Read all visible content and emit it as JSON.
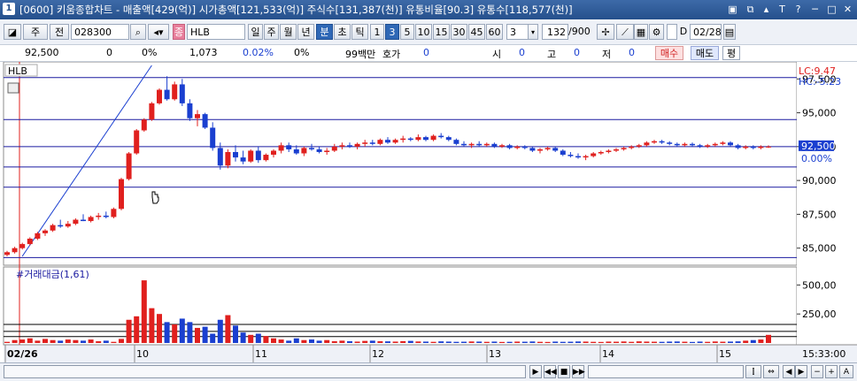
{
  "title": {
    "window_no": "1",
    "text": "[0600] 키움종합차트 - 매출액[429(억)] 시가총액[121,533(억)] 주식수[131,387(천)] 유통비율[90.3] 유통수[118,577(천)]"
  },
  "toolbar": {
    "market": "주",
    "prev": "전",
    "code": "028300",
    "badge": "종",
    "name": "HLB",
    "periods": [
      "일",
      "주",
      "월",
      "년",
      "분",
      "초",
      "틱"
    ],
    "selected_period": "분",
    "intervals": [
      "1",
      "3",
      "5",
      "10",
      "15",
      "30",
      "45",
      "60"
    ],
    "selected_interval": "3",
    "interval_value": "3",
    "count": "132",
    "count_total": "/900",
    "date_label": "D",
    "date": "02/28"
  },
  "quote": {
    "price": "92,500",
    "change": "0",
    "change_pct": "0%",
    "volume": "1,073",
    "volume_pct": "0.02%",
    "zero_pct": "0%",
    "amount": "99백만",
    "hoga_label": "호가",
    "hoga": "0",
    "open_label": "시",
    "open": "0",
    "high_label": "고",
    "high": "0",
    "low_label": "저",
    "low": "0",
    "buy_label": "매수",
    "sell_label": "매도",
    "avg_label": "평"
  },
  "colors": {
    "up": "#e0201e",
    "down": "#1a3fd0",
    "hline": "#1a1aa0",
    "trend": "#1a3fd0"
  },
  "chart_data": {
    "type": "candlestick",
    "symbol_label": "HLB",
    "lc_label": "LC:9.47",
    "hc_label": "HC:-5.23",
    "last_price_label": "92,500",
    "last_pct_label": "0.00%",
    "y_ticks": [
      "97,500",
      "95,000",
      "92,500",
      "90,000",
      "87,500",
      "85,000"
    ],
    "y_tick_values": [
      97500,
      95000,
      92500,
      90000,
      87500,
      85000
    ],
    "ylim": [
      84000,
      98500
    ],
    "h_lines": [
      97600,
      94500,
      92500,
      91000,
      89500,
      84300
    ],
    "date_labels": [
      "02/26",
      "10",
      "11",
      "12",
      "13",
      "14",
      "15"
    ],
    "time_label": "15:33:00",
    "candles": [
      [
        84500,
        84800,
        84400,
        84700
      ],
      [
        84700,
        85100,
        84600,
        85000
      ],
      [
        85000,
        85400,
        84900,
        85300
      ],
      [
        85300,
        85800,
        85200,
        85700
      ],
      [
        85700,
        86200,
        85600,
        86100
      ],
      [
        86100,
        86400,
        85900,
        86300
      ],
      [
        86300,
        86800,
        86200,
        86700
      ],
      [
        86700,
        87100,
        86500,
        86600
      ],
      [
        86600,
        87000,
        86500,
        86800
      ],
      [
        86800,
        87200,
        86700,
        87100
      ],
      [
        87100,
        87500,
        87000,
        87000
      ],
      [
        87000,
        87400,
        86900,
        87300
      ],
      [
        87300,
        87600,
        87100,
        87400
      ],
      [
        87400,
        87700,
        87200,
        87300
      ],
      [
        87300,
        88000,
        87200,
        87900
      ],
      [
        87900,
        90200,
        87800,
        90100
      ],
      [
        90100,
        92100,
        90000,
        92000
      ],
      [
        92000,
        93800,
        91900,
        93700
      ],
      [
        93700,
        94600,
        93600,
        94500
      ],
      [
        94500,
        95800,
        94400,
        95700
      ],
      [
        95700,
        96800,
        95600,
        96700
      ],
      [
        96700,
        97700,
        95900,
        96000
      ],
      [
        96000,
        97300,
        95900,
        97100
      ],
      [
        97100,
        97500,
        95500,
        95700
      ],
      [
        95700,
        96000,
        94400,
        94600
      ],
      [
        94600,
        95200,
        94000,
        94900
      ],
      [
        94900,
        95000,
        93800,
        93900
      ],
      [
        93900,
        94300,
        92200,
        92400
      ],
      [
        92400,
        92800,
        90800,
        91100
      ],
      [
        91100,
        92300,
        90900,
        92100
      ],
      [
        92100,
        92600,
        91400,
        91700
      ],
      [
        91700,
        92200,
        91200,
        91400
      ],
      [
        91400,
        92300,
        91300,
        92200
      ],
      [
        92200,
        92500,
        91300,
        91500
      ],
      [
        91500,
        92000,
        91400,
        91900
      ],
      [
        91900,
        92300,
        91700,
        92200
      ],
      [
        92200,
        92800,
        92000,
        92600
      ],
      [
        92600,
        92800,
        92100,
        92300
      ],
      [
        92300,
        92600,
        91900,
        92000
      ],
      [
        92000,
        92500,
        91800,
        92400
      ],
      [
        92400,
        92700,
        92200,
        92300
      ],
      [
        92300,
        92500,
        92000,
        92100
      ],
      [
        92100,
        92400,
        91900,
        92200
      ],
      [
        92200,
        92700,
        92100,
        92500
      ],
      [
        92500,
        92800,
        92300,
        92600
      ],
      [
        92600,
        92800,
        92400,
        92500
      ],
      [
        92500,
        92800,
        92300,
        92700
      ],
      [
        92700,
        93000,
        92500,
        92800
      ],
      [
        92800,
        93000,
        92600,
        92700
      ],
      [
        92700,
        93100,
        92600,
        93000
      ],
      [
        93000,
        93200,
        92700,
        92800
      ],
      [
        92800,
        93100,
        92700,
        93000
      ],
      [
        93000,
        93300,
        92800,
        93100
      ],
      [
        93100,
        93200,
        92900,
        93000
      ],
      [
        93000,
        93400,
        92900,
        93200
      ],
      [
        93200,
        93300,
        92900,
        93000
      ],
      [
        93000,
        93400,
        92900,
        93300
      ],
      [
        93300,
        93500,
        93100,
        93200
      ],
      [
        93200,
        93300,
        92900,
        93000
      ],
      [
        93000,
        93100,
        92600,
        92700
      ],
      [
        92700,
        92900,
        92500,
        92600
      ],
      [
        92600,
        92800,
        92400,
        92700
      ],
      [
        92700,
        92900,
        92500,
        92600
      ],
      [
        92600,
        92800,
        92500,
        92700
      ],
      [
        92700,
        92800,
        92400,
        92500
      ],
      [
        92500,
        92700,
        92400,
        92600
      ],
      [
        92600,
        92700,
        92300,
        92400
      ],
      [
        92400,
        92600,
        92300,
        92500
      ],
      [
        92500,
        92600,
        92300,
        92400
      ],
      [
        92400,
        92500,
        92100,
        92200
      ],
      [
        92200,
        92400,
        92000,
        92300
      ],
      [
        92300,
        92500,
        92200,
        92400
      ],
      [
        92400,
        92500,
        92100,
        92200
      ],
      [
        92200,
        92300,
        91800,
        91900
      ],
      [
        91900,
        92100,
        91700,
        91800
      ],
      [
        91800,
        92000,
        91600,
        91700
      ],
      [
        91700,
        91900,
        91500,
        91800
      ],
      [
        91800,
        92100,
        91700,
        92000
      ],
      [
        92000,
        92200,
        91900,
        92100
      ],
      [
        92100,
        92300,
        92000,
        92200
      ],
      [
        92200,
        92400,
        92100,
        92300
      ],
      [
        92300,
        92500,
        92200,
        92400
      ],
      [
        92400,
        92600,
        92300,
        92500
      ],
      [
        92500,
        92700,
        92400,
        92600
      ],
      [
        92600,
        92900,
        92500,
        92800
      ],
      [
        92800,
        93000,
        92700,
        92900
      ],
      [
        92900,
        93000,
        92700,
        92800
      ],
      [
        92800,
        92900,
        92600,
        92700
      ],
      [
        92700,
        92800,
        92500,
        92600
      ],
      [
        92600,
        92800,
        92500,
        92700
      ],
      [
        92700,
        92800,
        92500,
        92600
      ],
      [
        92600,
        92700,
        92400,
        92500
      ],
      [
        92500,
        92700,
        92400,
        92600
      ],
      [
        92600,
        92800,
        92500,
        92700
      ],
      [
        92700,
        92900,
        92600,
        92800
      ],
      [
        92800,
        92900,
        92500,
        92600
      ],
      [
        92600,
        92700,
        92300,
        92400
      ],
      [
        92400,
        92600,
        92300,
        92500
      ],
      [
        92500,
        92600,
        92300,
        92400
      ],
      [
        92400,
        92600,
        92300,
        92500
      ],
      [
        92500,
        92600,
        92400,
        92500
      ]
    ],
    "volume_panel": {
      "label": "#거래대금(1,61)",
      "y_ticks": [
        "500,00",
        "250,00"
      ],
      "y_tick_values": [
        500,
        250
      ],
      "ylim": [
        0,
        640
      ],
      "h_lines": [
        160,
        100,
        55
      ],
      "values": [
        10,
        25,
        30,
        40,
        20,
        35,
        25,
        20,
        30,
        25,
        20,
        30,
        15,
        20,
        10,
        35,
        200,
        230,
        540,
        300,
        250,
        180,
        160,
        210,
        180,
        130,
        140,
        80,
        200,
        240,
        150,
        90,
        70,
        80,
        60,
        40,
        30,
        20,
        40,
        25,
        30,
        20,
        25,
        15,
        20,
        15,
        12,
        18,
        20,
        15,
        14,
        12,
        16,
        18,
        13,
        12,
        10,
        14,
        12,
        10,
        11,
        13,
        12,
        10,
        12,
        9,
        10,
        12,
        11,
        13,
        10,
        9,
        12,
        10,
        11,
        13,
        12,
        10,
        9,
        12,
        11,
        13,
        10,
        14,
        12,
        11,
        10,
        12,
        13,
        11,
        9,
        12,
        10,
        13,
        11,
        12,
        14,
        20,
        25,
        30,
        70
      ]
    }
  }
}
